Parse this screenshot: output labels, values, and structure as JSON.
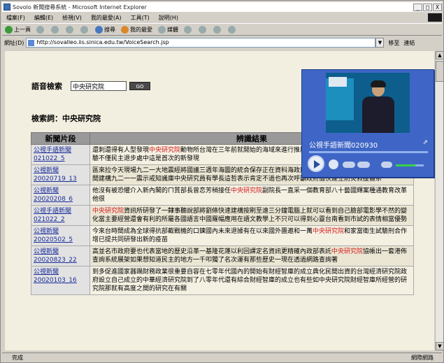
{
  "window": {
    "title": "Sovolo 新聞搜尋系統 - Microsoft Internet Explorer",
    "min_label": "_",
    "max_label": "□",
    "close_label": "X"
  },
  "menu": [
    "檔案(F)",
    "編輯(E)",
    "檢視(V)",
    "我的最愛(A)",
    "工具(T)",
    "說明(H)"
  ],
  "toolbar": {
    "back": "上一頁",
    "search": "搜尋",
    "favorites": "我的最愛",
    "media": "媒體"
  },
  "address": {
    "label": "網址(D)",
    "url": "http://sovalleo.iis.sinica.edu.tw/VoiceSearch.jsp",
    "go": "移至",
    "links": "連結"
  },
  "search": {
    "label": "語音檢索",
    "value": "中央研究院",
    "button": "GO"
  },
  "keyword": "檢索詞：中央研究院",
  "table": {
    "headers": [
      "新聞片段",
      "辨識結果"
    ],
    "rows": [
      {
        "link1": "公視手語新聞",
        "link2": "021022_5",
        "text_pre": "還刺還得有人型發現",
        "highlight": "中央研究院",
        "text_post": "動物所台灣在三年前就開始的海域來進行推展的研究三年來在台灣海域發現熱心體驗不僅民主退步處中這是首次的新發現"
      },
      {
        "link1": "公視新聞",
        "link2": "20020719_13",
        "text_pre": "區來拉今天現場九二一大地震經將國議三週年海圖的統合保存正在資科海政府機列五千東萬元預算興針創在兩年時間建構九二一一震示戒知識庫中央研究員有學長這哲表示肯定不過也再次呼籲政府儘快建立防災救援體系",
        "highlight": "",
        "text_post": ""
      },
      {
        "link1": "公視新聞",
        "link2": "20020208_6",
        "text_pre": "他沒有被恐懼介入新內閣的ㄇ質部長曾恋芳稍接任",
        "highlight": "中央研究院",
        "text_post": "副院長一直采一個教育部八十藝國輝案種通教育改革他很"
      },
      {
        "link1": "公視手語新聞",
        "link2": "021022_2",
        "text_pre": "",
        "highlight": "中央研究院",
        "text_post": "資訊所研發了一隸事聽說部將劉條快速建構按刷至遠三分鐘電腦上就可以看到自己臉部電影學不然的變化當主要經營還會有利的所屬各國語言中國羅幅應用在語文教學上不只可以得到心靈台南看到市試的表情相當優勢"
      },
      {
        "link1": "公視新聞",
        "link2": "20020502_5",
        "text_pre": "今來台時間成為全球得抗部截戰機的口鍊國內未來退據有在以來國外團邀和一萬",
        "highlight": "中央研究院",
        "text_post": "和家當衛生試驗刑合作增已提共同研發出新的疫苗"
      },
      {
        "link1": "公視新聞",
        "link2": "20020823_22",
        "text_pre": "高並名市政府要也代表當地的歷史沿革一基隆花蓮以利回課定名資訊更精確內政部表託",
        "highlight": "中央研究院",
        "text_post": "協帳出一套港佈查詢系統展架如果想知道民主的地方一千叩獨了名次運有那些歷史一現在透過網路查詢著"
      },
      {
        "link1": "公視新聞",
        "link2": "20020103_16",
        "text_pre": "到多促進國家器蹋財務政業很重要自容在七零年代國內的開始有財經智庫的成立典化民間出資的台灣經濟研究院政府設立自己成立的中華經濟研究院到了八零年代還有綜合財經智庫的成立也有些如中央研究院財經智庫所經營的研究院那就有高度之間的研究在有關",
        "highlight": "",
        "text_post": ""
      }
    ]
  },
  "player": {
    "title": "公視手語新聞020930"
  },
  "status": {
    "text": "完成",
    "zone": "網際網路"
  }
}
